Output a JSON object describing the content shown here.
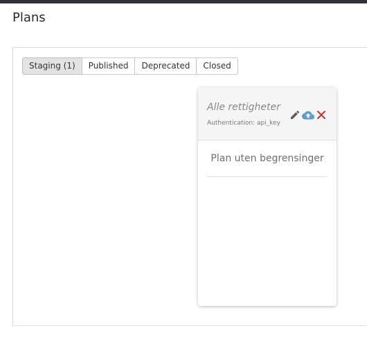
{
  "page": {
    "title": "Plans"
  },
  "tabs": [
    {
      "label": "Staging (1)",
      "active": true
    },
    {
      "label": "Published",
      "active": false
    },
    {
      "label": "Deprecated",
      "active": false
    },
    {
      "label": "Closed",
      "active": false
    }
  ],
  "plan_card": {
    "title": "Alle rettigheter",
    "subtitle": "Authentication: api_key",
    "actions": [
      {
        "icon": "pencil-icon",
        "color": "#5b5b5b"
      },
      {
        "icon": "cloud-upload-icon",
        "color": "#5c9fc9"
      },
      {
        "icon": "close-icon",
        "color": "#d0312d"
      }
    ],
    "items": [
      "Plan uten begrensinger"
    ]
  }
}
